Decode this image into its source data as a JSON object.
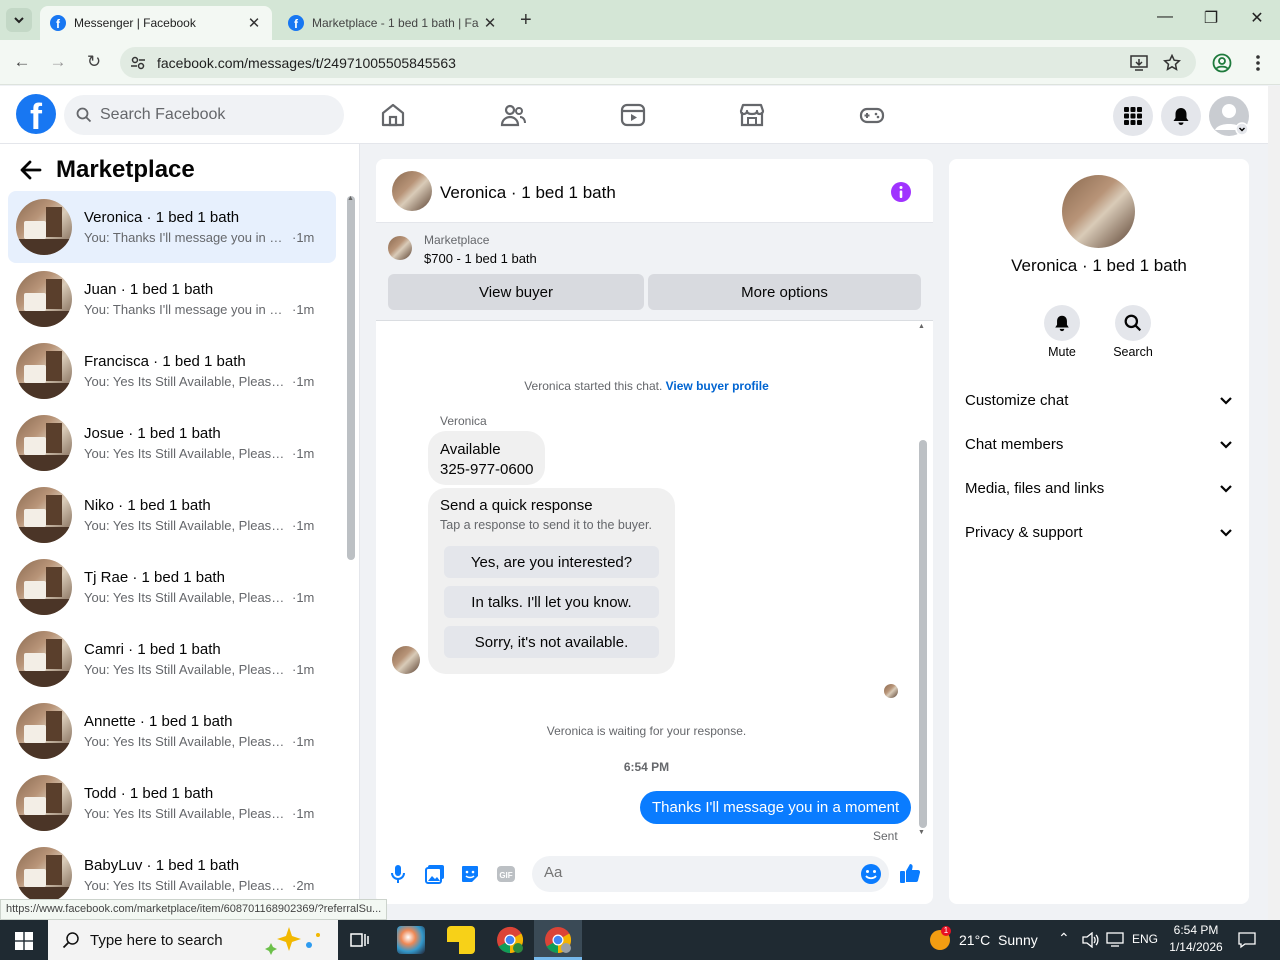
{
  "browser": {
    "tabs": [
      {
        "label": "Messenger | Facebook"
      },
      {
        "label": "Marketplace - 1 bed 1 bath | Fa"
      }
    ],
    "url": "facebook.com/messages/t/24971005505845563",
    "status_url": "https://www.facebook.com/marketplace/item/608701168902369/?referralSu..."
  },
  "header": {
    "logo_letter": "f",
    "search_placeholder": "Search Facebook"
  },
  "sidebar": {
    "title": "Marketplace",
    "conversations": [
      {
        "name": "Veronica · 1 bed 1 bath",
        "preview": "You: Thanks I'll message you in a ...",
        "time": "·1m"
      },
      {
        "name": "Juan · 1 bed 1 bath",
        "preview": "You: Thanks I'll message you in a ...",
        "time": "·1m"
      },
      {
        "name": "Francisca · 1 bed 1 bath",
        "preview": "You: Yes Its Still Available, Please S...",
        "time": "·1m"
      },
      {
        "name": "Josue · 1 bed 1 bath",
        "preview": "You: Yes Its Still Available, Please S...",
        "time": "·1m"
      },
      {
        "name": "Niko · 1 bed 1 bath",
        "preview": "You: Yes Its Still Available, Please S...",
        "time": "·1m"
      },
      {
        "name": "Tj Rae · 1 bed 1 bath",
        "preview": "You: Yes Its Still Available, Please S...",
        "time": "·1m"
      },
      {
        "name": "Camri · 1 bed 1 bath",
        "preview": "You: Yes Its Still Available, Please S...",
        "time": "·1m"
      },
      {
        "name": "Annette · 1 bed 1 bath",
        "preview": "You: Yes Its Still Available, Please S...",
        "time": "·1m"
      },
      {
        "name": "Todd · 1 bed 1 bath",
        "preview": "You: Yes Its Still Available, Please S...",
        "time": "·1m"
      },
      {
        "name": "BabyLuv · 1 bed 1 bath",
        "preview": "You: Yes Its Still Available, Please S...",
        "time": "·2m"
      }
    ]
  },
  "chat": {
    "title": "Veronica · 1 bed 1 bath",
    "marketplace_label": "Marketplace",
    "listing": "$700 - 1 bed 1 bath",
    "view_buyer": "View buyer",
    "more_options": "More options",
    "started_text": "Veronica started this chat.",
    "view_buyer_profile": "View buyer profile",
    "sender_name": "Veronica",
    "message_line1": "Available",
    "message_line2": "325-977-0600",
    "quick_title": "Send a quick response",
    "quick_sub": "Tap a response to send it to the buyer.",
    "quick_responses": [
      "Yes, are you interested?",
      "In talks. I'll let you know.",
      "Sorry, it's not available."
    ],
    "waiting_text": "Veronica is waiting for your response.",
    "timestamp": "6:54 PM",
    "sent_message": "Thanks I'll message you in a moment",
    "sent_status": "Sent",
    "input_placeholder": "Aa"
  },
  "details": {
    "name": "Veronica · 1 bed 1 bath",
    "mute_label": "Mute",
    "search_label": "Search",
    "sections": [
      "Customize chat",
      "Chat members",
      "Media, files and links",
      "Privacy & support"
    ]
  },
  "taskbar": {
    "search_placeholder": "Type here to search",
    "weather": "21°C  Sunny",
    "weather_badge": "1",
    "language": "ENG",
    "time": "6:54 PM",
    "date": "1/14/2026"
  },
  "colors": {
    "fb_blue": "#1877f2",
    "messenger_blue": "#0a7cff",
    "info_purple": "#a033ff"
  }
}
